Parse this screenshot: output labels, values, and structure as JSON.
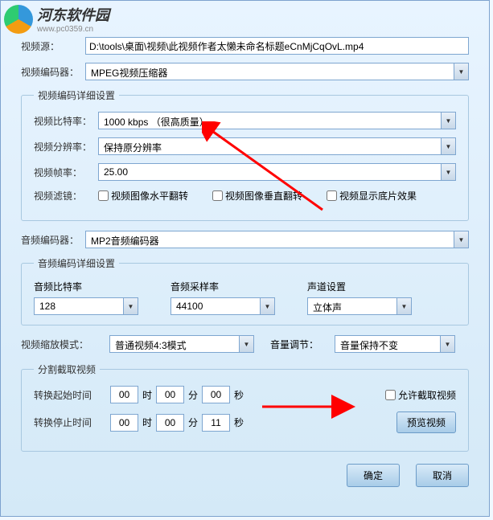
{
  "watermark": {
    "title": "河东软件园",
    "url": "www.pc0359.cn"
  },
  "source": {
    "label": "视频源：",
    "value": "D:\\tools\\桌面\\视频\\此视频作者太懒未命名标题eCnMjCqOvL.mp4"
  },
  "videoEncoder": {
    "label": "视频编码器：",
    "value": "MPEG视频压缩器"
  },
  "videoDetail": {
    "legend": "视频编码详细设置",
    "bitrate": {
      "label": "视频比特率：",
      "value": "1000 kbps （很高质量）"
    },
    "resolution": {
      "label": "视频分辨率：",
      "value": "保持原分辨率"
    },
    "framerate": {
      "label": "视频帧率：",
      "value": "25.00"
    },
    "filter": {
      "label": "视频滤镜：",
      "flipH": "视频图像水平翻转",
      "flipV": "视频图像垂直翻转",
      "negative": "视频显示底片效果"
    }
  },
  "audioEncoder": {
    "label": "音频编码器：",
    "value": "MP2音频编码器"
  },
  "audioDetail": {
    "legend": "音频编码详细设置",
    "bitrate": {
      "label": "音频比特率",
      "value": "128"
    },
    "samplerate": {
      "label": "音频采样率",
      "value": "44100"
    },
    "channel": {
      "label": "声道设置",
      "value": "立体声"
    }
  },
  "scale": {
    "label": "视频缩放模式：",
    "value": "普通视频4:3模式"
  },
  "volume": {
    "label": "音量调节：",
    "value": "音量保持不变"
  },
  "cut": {
    "legend": "分割截取视频",
    "startLabel": "转换起始时间",
    "stopLabel": "转换停止时间",
    "start": {
      "h": "00",
      "m": "00",
      "s": "00"
    },
    "stop": {
      "h": "00",
      "m": "00",
      "s": "11"
    },
    "hour": "时",
    "min": "分",
    "sec": "秒",
    "allow": "允许截取视频",
    "preview": "预览视频"
  },
  "buttons": {
    "ok": "确定",
    "cancel": "取消"
  }
}
